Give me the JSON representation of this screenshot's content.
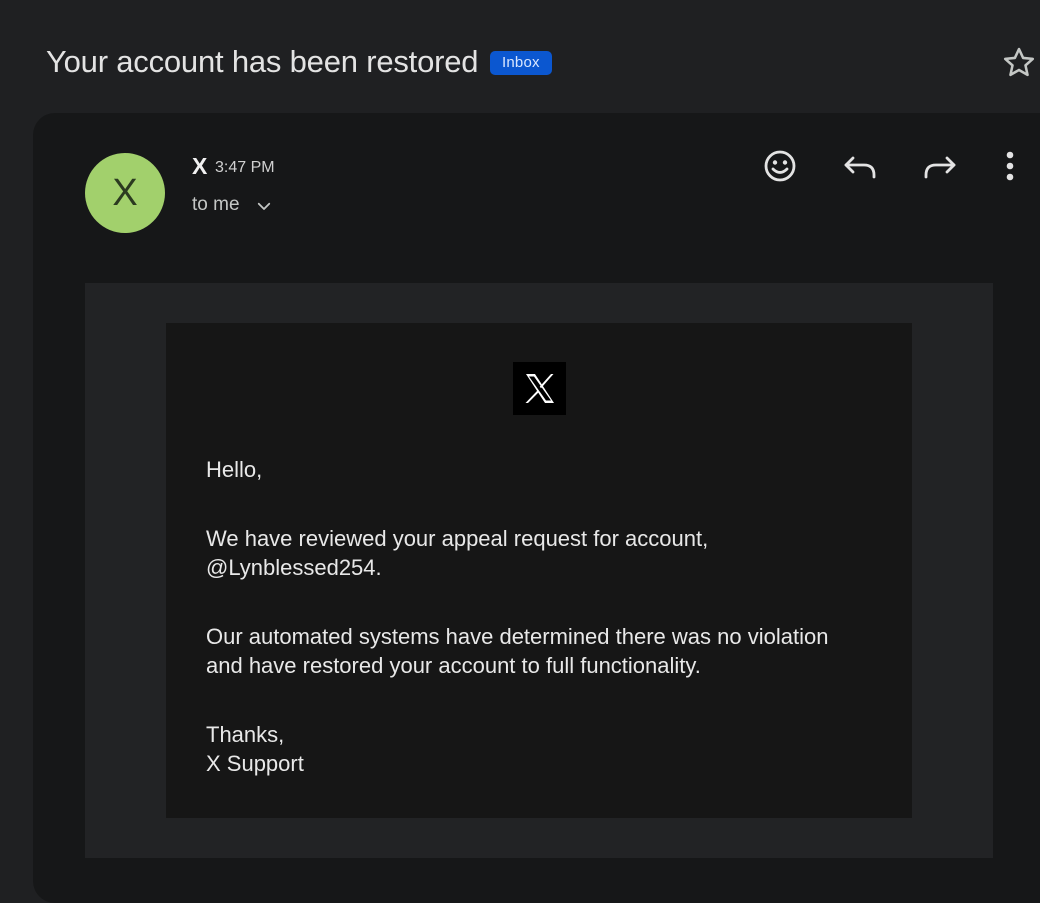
{
  "email": {
    "subject": "Your account has been restored",
    "label": "Inbox",
    "sender": {
      "avatar_letter": "X",
      "name": "X",
      "time": "3:47 PM",
      "recipient": "to me"
    },
    "actions": [
      "emoji-react-icon",
      "reply-icon",
      "forward-icon",
      "more-options-icon"
    ],
    "body": {
      "logo": "X",
      "greeting": "Hello,",
      "paragraph1_line1": "We have reviewed your appeal request for account,",
      "paragraph1_line2": "@Lynblessed254.",
      "paragraph2_line1": "Our automated systems have determined there was no violation",
      "paragraph2_line2": "and have restored your account to full functionality.",
      "signoff": "Thanks,",
      "signature": "X Support"
    }
  },
  "colors": {
    "background": "#1f2022",
    "card": "#161718",
    "avatar": "#a2d06c",
    "badge": "#0b57d0"
  }
}
